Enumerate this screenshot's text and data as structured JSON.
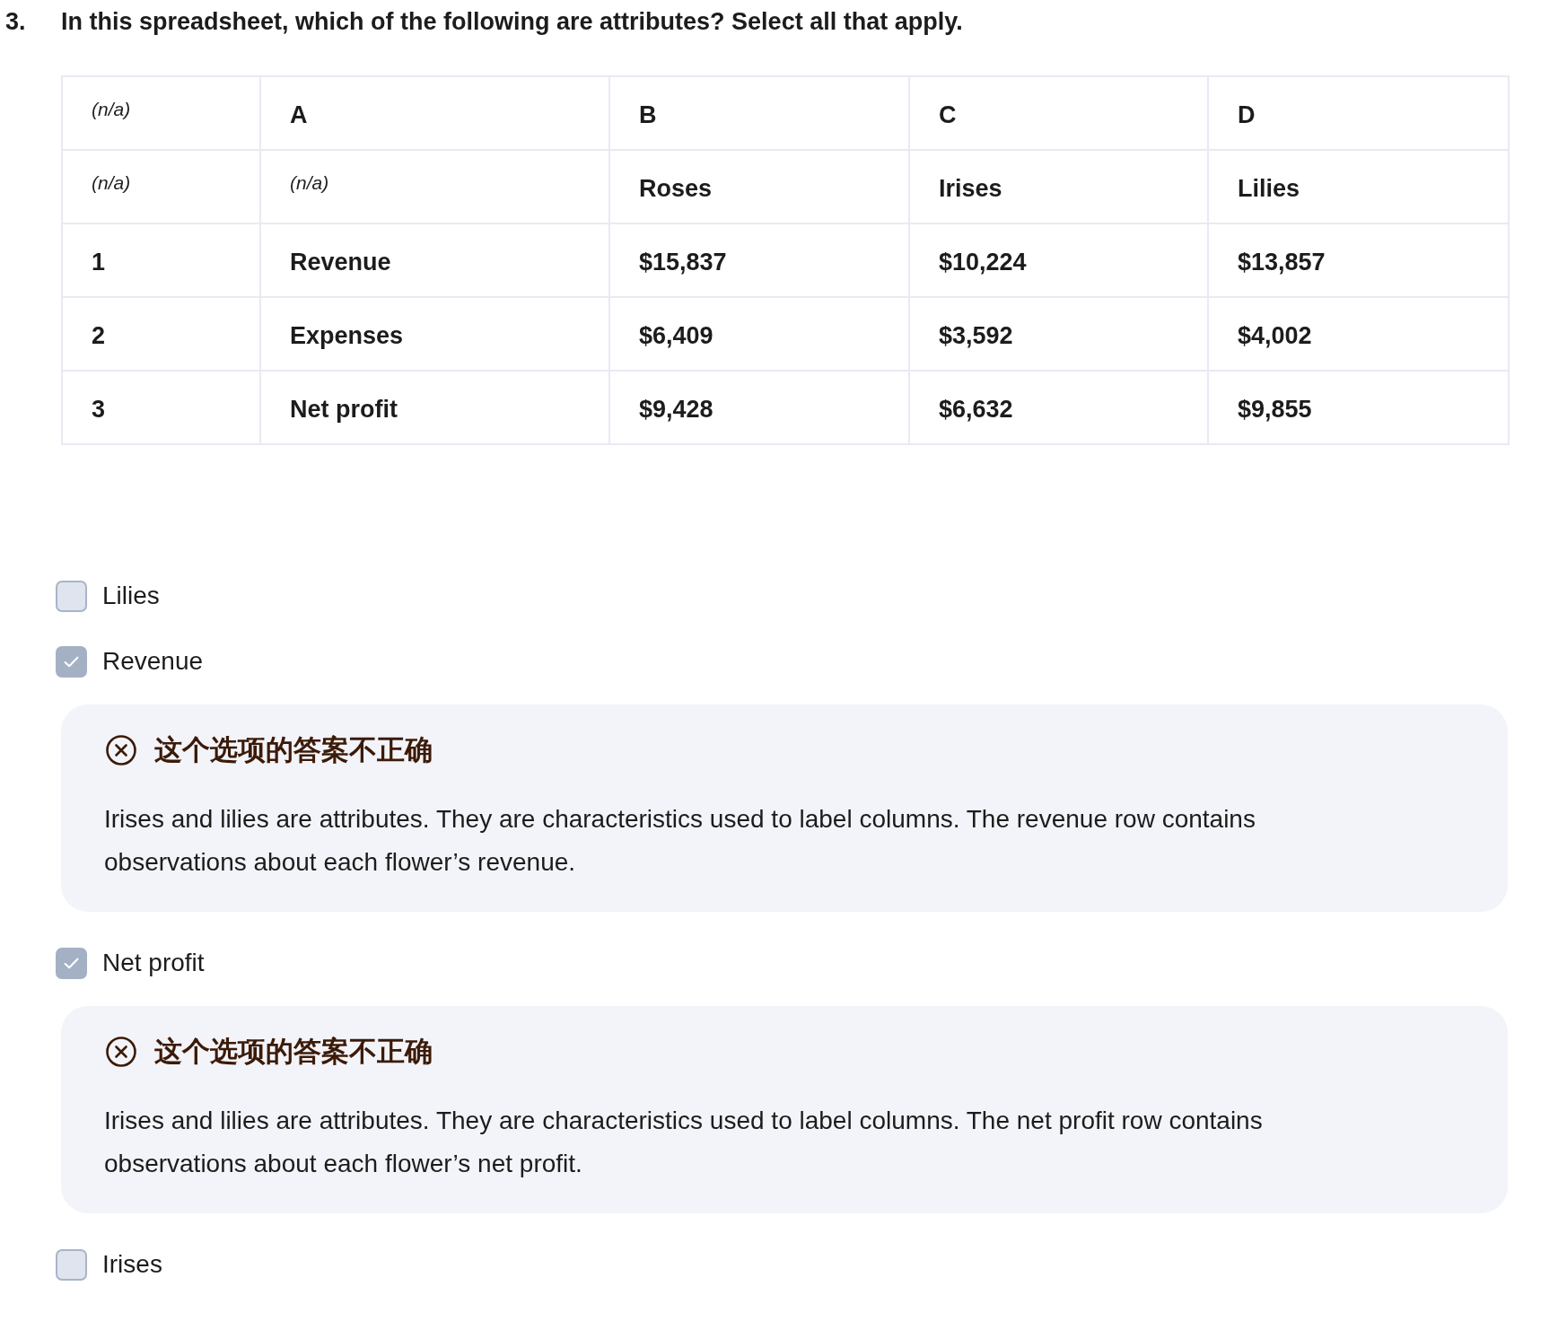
{
  "question": {
    "number": "3.",
    "text": "In this spreadsheet, which of the following are attributes? Select all that apply."
  },
  "table": {
    "rows": [
      [
        {
          "text": "(n/a)",
          "kind": "na"
        },
        {
          "text": "A",
          "kind": "text"
        },
        {
          "text": "B",
          "kind": "text"
        },
        {
          "text": "C",
          "kind": "text"
        },
        {
          "text": "D",
          "kind": "text"
        }
      ],
      [
        {
          "text": "(n/a)",
          "kind": "na"
        },
        {
          "text": "(n/a)",
          "kind": "na"
        },
        {
          "text": "Roses",
          "kind": "text"
        },
        {
          "text": "Irises",
          "kind": "text"
        },
        {
          "text": "Lilies",
          "kind": "text"
        }
      ],
      [
        {
          "text": "1",
          "kind": "text"
        },
        {
          "text": "Revenue",
          "kind": "text"
        },
        {
          "text": "$15,837",
          "kind": "text"
        },
        {
          "text": "$10,224",
          "kind": "text"
        },
        {
          "text": "$13,857",
          "kind": "text"
        }
      ],
      [
        {
          "text": "2",
          "kind": "text"
        },
        {
          "text": "Expenses",
          "kind": "text"
        },
        {
          "text": "$6,409",
          "kind": "text"
        },
        {
          "text": "$3,592",
          "kind": "text"
        },
        {
          "text": "$4,002",
          "kind": "text"
        }
      ],
      [
        {
          "text": "3",
          "kind": "text"
        },
        {
          "text": "Net profit",
          "kind": "text"
        },
        {
          "text": "$9,428",
          "kind": "text"
        },
        {
          "text": "$6,632",
          "kind": "text"
        },
        {
          "text": "$9,855",
          "kind": "text"
        }
      ]
    ]
  },
  "options": [
    {
      "label": "Lilies",
      "checked": false
    },
    {
      "label": "Revenue",
      "checked": true,
      "feedback": {
        "correct": false,
        "title": "这个选项的答案不正确",
        "text": "Irises and lilies are attributes. They are characteristics used to label columns. The revenue row contains observations about each flower’s revenue."
      }
    },
    {
      "label": "Net profit",
      "checked": true,
      "feedback": {
        "correct": false,
        "title": "这个选项的答案不正确",
        "text": "Irises and lilies are attributes. They are characteristics used to label columns. The net profit row contains observations about each flower’s net profit."
      }
    },
    {
      "label": "Irises",
      "checked": false
    }
  ]
}
